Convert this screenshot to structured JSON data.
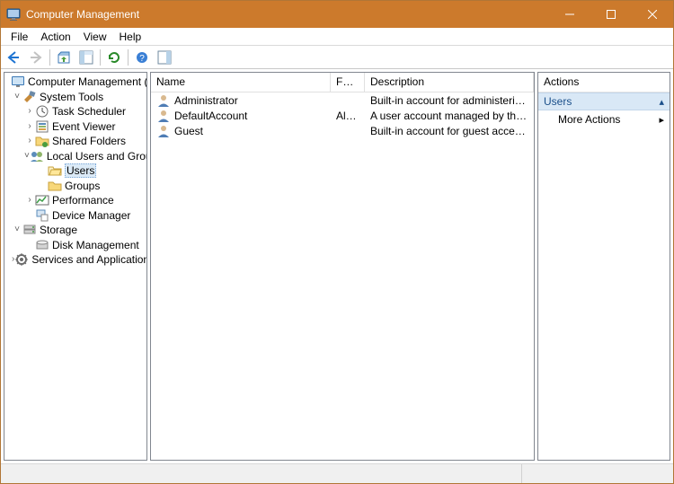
{
  "window": {
    "title": "Computer Management"
  },
  "menubar": [
    "File",
    "Action",
    "View",
    "Help"
  ],
  "tree": {
    "root": "Computer Management (Local)",
    "system_tools": "System Tools",
    "task_scheduler": "Task Scheduler",
    "event_viewer": "Event Viewer",
    "shared_folders": "Shared Folders",
    "local_users": "Local Users and Groups",
    "users": "Users",
    "groups": "Groups",
    "performance": "Performance",
    "device_manager": "Device Manager",
    "storage": "Storage",
    "disk_mgmt": "Disk Management",
    "services_apps": "Services and Applications"
  },
  "list": {
    "headers": {
      "name": "Name",
      "full": "Full ...",
      "desc": "Description"
    },
    "rows": [
      {
        "name": "Administrator",
        "full": "",
        "desc": "Built-in account for administering..."
      },
      {
        "name": "DefaultAccount",
        "full": "Alex...",
        "desc": "A user account managed by the s..."
      },
      {
        "name": "Guest",
        "full": "",
        "desc": "Built-in account for guest access t..."
      }
    ]
  },
  "actions": {
    "title": "Actions",
    "group": "Users",
    "more": "More Actions"
  }
}
